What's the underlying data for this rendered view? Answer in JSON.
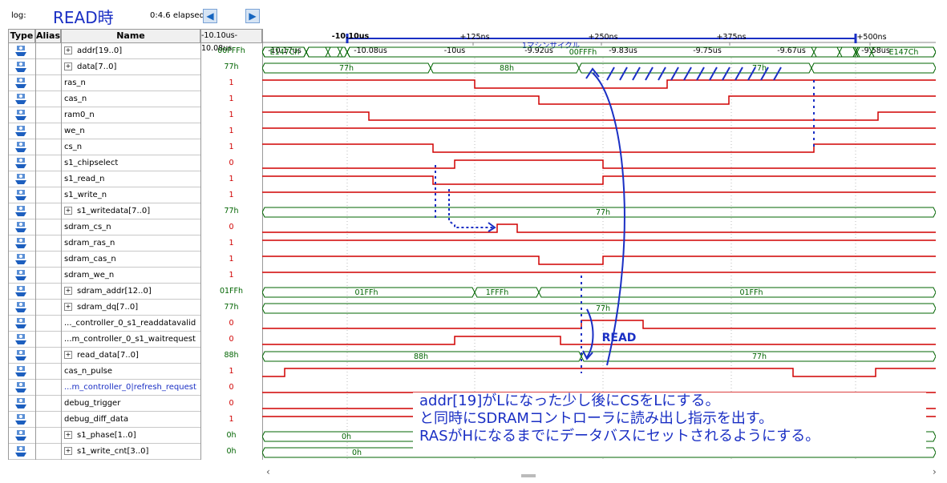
{
  "toolbar": {
    "log_label": "log:",
    "read_title": "READ時",
    "elapsed": "0:4.6 elapsed",
    "prev_icon": "left-arrow-icon",
    "next_icon": "right-arrow-icon"
  },
  "ruler": {
    "cursor_label": "-10.10us",
    "left_time_1": "-10.10us",
    "left_time_2": "-10.08us",
    "top_ticks": [
      "+125ns",
      "+250ns",
      "+375ns",
      "+500ns"
    ],
    "bottom_ticks": [
      "-10.17us",
      "-10.08us",
      "-10us",
      "-9.92us",
      "-9.83us",
      "-9.75us",
      "-9.67us",
      "-9.58us"
    ],
    "machine_cycle": "1マシンサイクル"
  },
  "columns": {
    "type": "Type",
    "alias": "Alias",
    "name": "Name"
  },
  "signals": [
    {
      "name": "addr[19..0]",
      "bus": true,
      "value": "00FFFh"
    },
    {
      "name": "data[7..0]",
      "bus": true,
      "value": "77h"
    },
    {
      "name": "ras_n",
      "bus": false,
      "value": "1"
    },
    {
      "name": "cas_n",
      "bus": false,
      "value": "1"
    },
    {
      "name": "ram0_n",
      "bus": false,
      "value": "1"
    },
    {
      "name": "we_n",
      "bus": false,
      "value": "1"
    },
    {
      "name": "cs_n",
      "bus": false,
      "value": "1"
    },
    {
      "name": "s1_chipselect",
      "bus": false,
      "value": "0"
    },
    {
      "name": "s1_read_n",
      "bus": false,
      "value": "1"
    },
    {
      "name": "s1_write_n",
      "bus": false,
      "value": "1"
    },
    {
      "name": "s1_writedata[7..0]",
      "bus": true,
      "value": "77h"
    },
    {
      "name": "sdram_cs_n",
      "bus": false,
      "value": "0"
    },
    {
      "name": "sdram_ras_n",
      "bus": false,
      "value": "1"
    },
    {
      "name": "sdram_cas_n",
      "bus": false,
      "value": "1"
    },
    {
      "name": "sdram_we_n",
      "bus": false,
      "value": "1"
    },
    {
      "name": "sdram_addr[12..0]",
      "bus": true,
      "value": "01FFh"
    },
    {
      "name": "sdram_dq[7..0]",
      "bus": true,
      "value": "77h"
    },
    {
      "name": "..._controller_0_s1_readdatavalid",
      "bus": false,
      "value": "0"
    },
    {
      "name": "...m_controller_0_s1_waitrequest",
      "bus": false,
      "value": "0"
    },
    {
      "name": "read_data[7..0]",
      "bus": true,
      "value": "88h"
    },
    {
      "name": "cas_n_pulse",
      "bus": false,
      "value": "1"
    },
    {
      "name": "...m_controller_0|refresh_request",
      "bus": false,
      "value": "0",
      "blue": true
    },
    {
      "name": "debug_trigger",
      "bus": false,
      "value": "0"
    },
    {
      "name": "debug_diff_data",
      "bus": false,
      "value": "1"
    },
    {
      "name": "s1_phase[1..0]",
      "bus": true,
      "value": "0h"
    },
    {
      "name": "s1_write_cnt[3..0]",
      "bus": true,
      "value": "0h"
    }
  ],
  "bus_labels": {
    "addr": [
      "E147Ch",
      "00FFFh",
      "E147Ch"
    ],
    "data": [
      "77h",
      "88h",
      "77h"
    ],
    "s1_writedata": [
      "77h"
    ],
    "sdram_addr": [
      "01FFh",
      "1FFFh",
      "01FFh"
    ],
    "sdram_dq": [
      "77h"
    ],
    "read_data": [
      "88h",
      "77h"
    ],
    "s1_phase": [
      "0h"
    ],
    "s1_write_cnt": [
      "0h"
    ]
  },
  "annotations": {
    "read_label": "READ",
    "note_lines": [
      "addr[19]がLになった少し後にCSをLにする。",
      "と同時にSDRAMコントローラに読み出し指示を出す。",
      "RASがHになるまでにデータバスにセットされるようにする。"
    ]
  },
  "colors": {
    "signal": "#d00000",
    "bus": "#006400",
    "annotation": "#1a2fc4",
    "cursor": "#1a2fc4"
  },
  "scroll": {
    "left_icon": "chevron-left-icon",
    "right_icon": "chevron-right-icon"
  }
}
